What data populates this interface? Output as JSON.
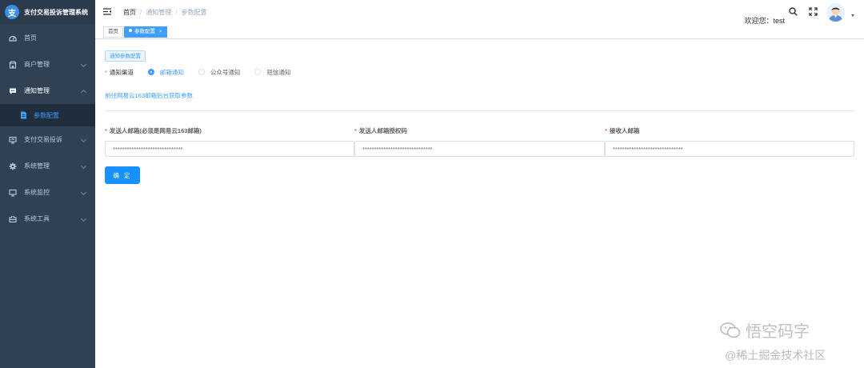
{
  "app": {
    "title": "支付交易投诉管理系统",
    "logo_letter": "支"
  },
  "sidebar": {
    "items": [
      {
        "label": "首页",
        "icon": "dashboard-icon",
        "has_arrow": false
      },
      {
        "label": "商户管理",
        "icon": "shop-icon",
        "has_arrow": true
      },
      {
        "label": "通知管理",
        "icon": "message-icon",
        "has_arrow": true,
        "open": true
      },
      {
        "label": "支付交易投诉",
        "icon": "monitor-icon",
        "has_arrow": true
      },
      {
        "label": "系统管理",
        "icon": "gear-icon",
        "has_arrow": true
      },
      {
        "label": "系统监控",
        "icon": "monitor-icon",
        "has_arrow": true
      },
      {
        "label": "系统工具",
        "icon": "toolbox-icon",
        "has_arrow": true
      }
    ],
    "sub_active": {
      "label": "参数配置",
      "icon": "document-icon"
    }
  },
  "header": {
    "breadcrumb": [
      "首页",
      "通知管理",
      "参数配置"
    ],
    "welcome": "欢迎您：test"
  },
  "tags": [
    {
      "label": "首页",
      "active": false
    },
    {
      "label": "参数配置",
      "active": true,
      "close": "×"
    }
  ],
  "main": {
    "section_button": "通知参数配置",
    "channel": {
      "label": "通知渠道",
      "options": [
        {
          "label": "邮箱通知",
          "checked": true
        },
        {
          "label": "公众号通知",
          "checked": false
        },
        {
          "label": "短信通知",
          "checked": false
        }
      ]
    },
    "link_text": "前往网易云163邮箱后台获取参数",
    "fields": [
      {
        "label": "发送人邮箱(必须是网易云163邮箱)",
        "value": "******************************"
      },
      {
        "label": "发送人邮箱授权码",
        "value": "******************************"
      },
      {
        "label": "接收人邮箱",
        "value": "******************************"
      }
    ],
    "confirm_label": "确 定"
  },
  "watermark": {
    "line1": "悟空码字",
    "line2": "@稀土掘金技术社区"
  },
  "colors": {
    "sidebar_bg": "#304156",
    "primary": "#409eff",
    "required": "#f56c6c"
  }
}
